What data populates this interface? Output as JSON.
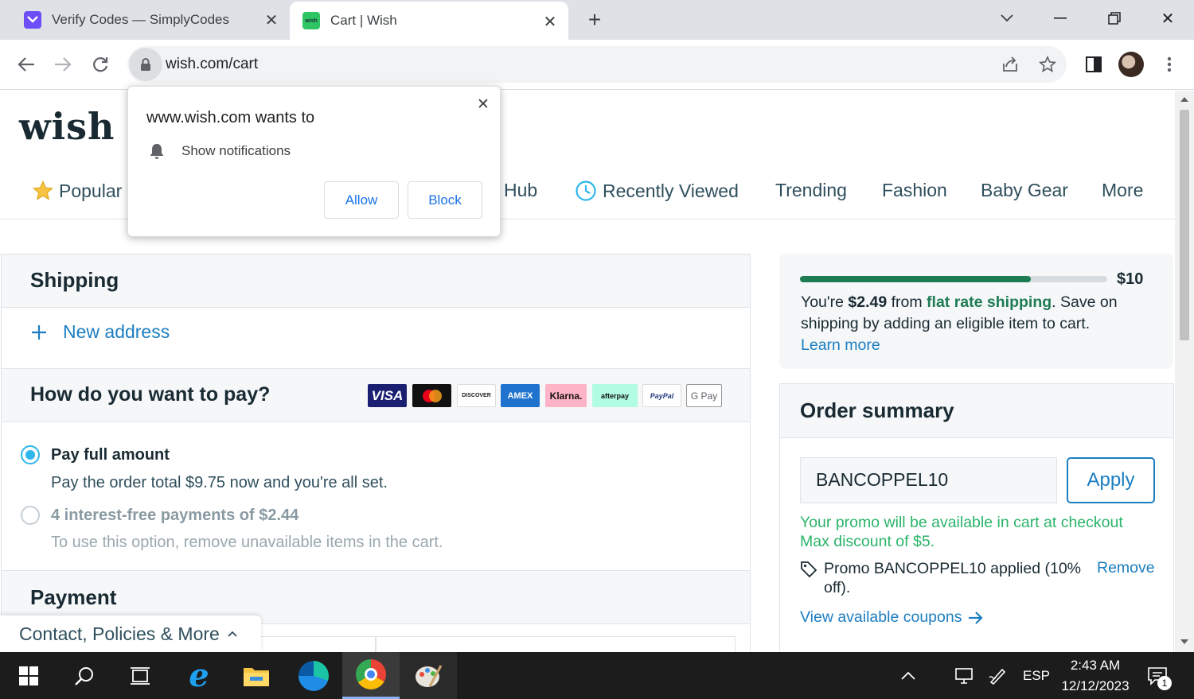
{
  "browser": {
    "tabs": [
      {
        "title": "Verify Codes — SimplyCodes",
        "active": false
      },
      {
        "title": "Cart | Wish",
        "active": true
      }
    ],
    "url": "wish.com/cart"
  },
  "permission_popup": {
    "title": "www.wish.com wants to",
    "request": "Show notifications",
    "allow_label": "Allow",
    "block_label": "Block"
  },
  "site": {
    "logo": "wish",
    "nav": [
      "Popular",
      "Hub",
      "Recently Viewed",
      "Trending",
      "Fashion",
      "Baby Gear",
      "More"
    ]
  },
  "shipping": {
    "title": "Shipping",
    "new_address": "New address"
  },
  "payment_method": {
    "title": "How do you want to pay?",
    "logos": [
      "VISA",
      "Mastercard",
      "DISCOVER",
      "AMEX",
      "Klarna.",
      "afterpay",
      "PayPal",
      "G Pay"
    ],
    "options": [
      {
        "label": "Pay full amount",
        "description": "Pay the order total $9.75 now and you're all set.",
        "selected": true
      },
      {
        "label": "4 interest-free payments of $2.44",
        "description": "To use this option, remove unavailable items in the cart.",
        "selected": false
      }
    ],
    "payment_title": "Payment"
  },
  "footer_bar": {
    "label": "Contact, Policies & More"
  },
  "flat_rate": {
    "target": "$10",
    "progress": 0.75,
    "text_a": "You're ",
    "amount": "$2.49",
    "text_b": " from ",
    "link_bold": "flat rate shipping",
    "text_c": ". Save on shipping by adding an eligible item to cart.",
    "learn_more": "Learn more"
  },
  "order_summary": {
    "title": "Order summary",
    "promo_code": "BANCOPPEL10",
    "apply_label": "Apply",
    "promo_note_1": "Your promo will be available in cart at checkout",
    "promo_note_2": "Max discount of $5.",
    "promo_applied": "Promo BANCOPPEL10 applied (10% off).",
    "remove_label": "Remove",
    "view_coupons": "View available coupons"
  },
  "taskbar": {
    "language": "ESP",
    "time": "2:43 AM",
    "date": "12/12/2023",
    "notification_count": "1"
  },
  "colors": {
    "wish_link": "#1c7ec1",
    "green": "#1e7c53",
    "promo_green": "#2ab469",
    "radio_blue": "#2fb7ec"
  }
}
